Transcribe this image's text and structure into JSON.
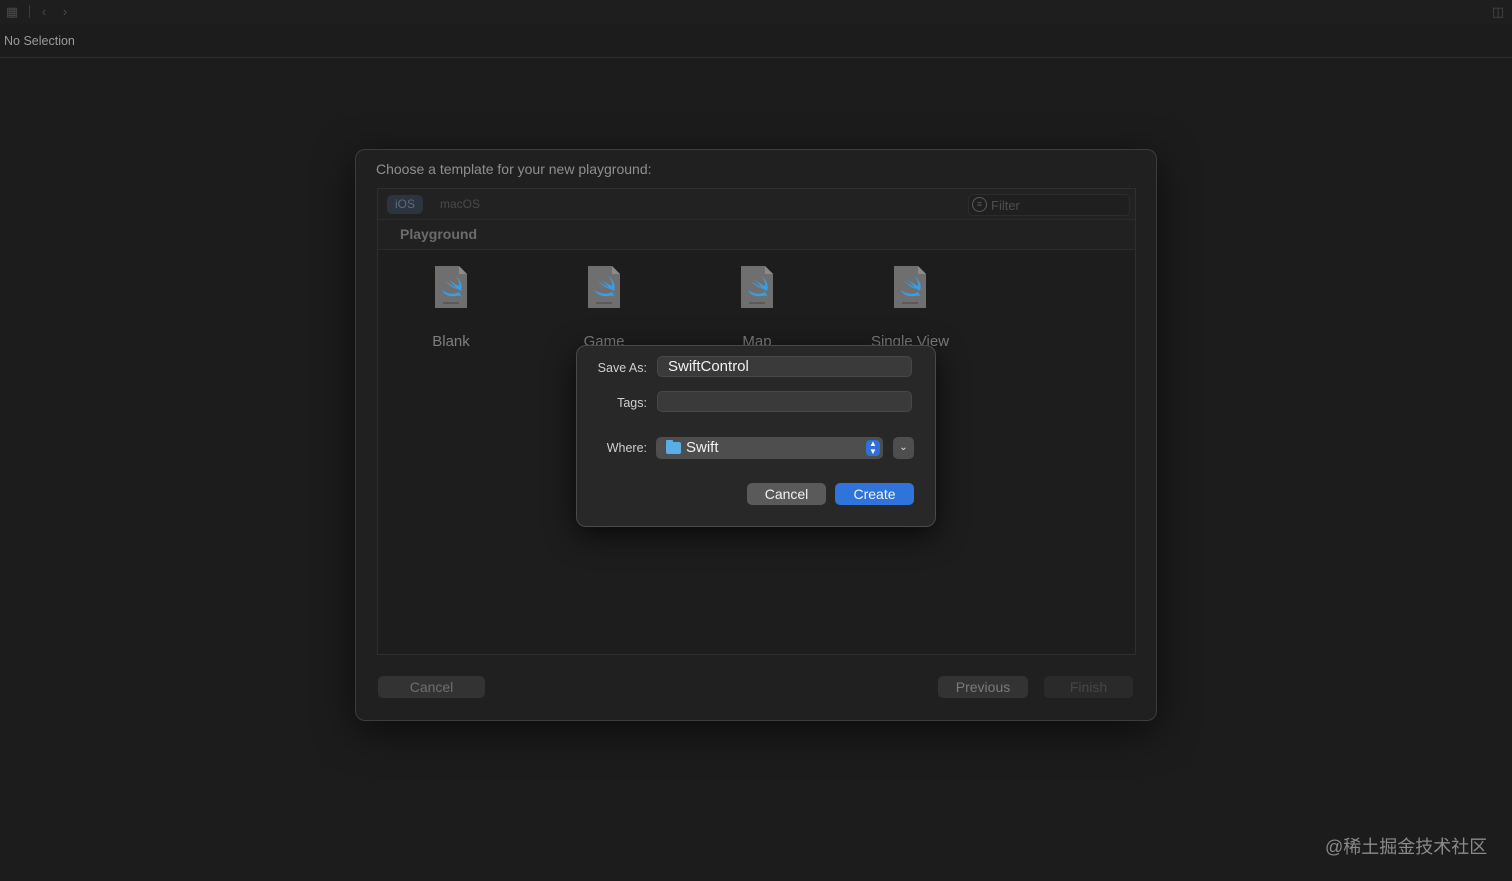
{
  "status": {
    "no_selection": "No Selection"
  },
  "template_sheet": {
    "title": "Choose a template for your new playground:",
    "tabs": [
      {
        "label": "iOS",
        "selected": true
      },
      {
        "label": "macOS",
        "selected": false
      }
    ],
    "filter_placeholder": "Filter",
    "section": "Playground",
    "templates": [
      {
        "label": "Blank",
        "icon": "swift-playground-file-icon"
      },
      {
        "label": "Game",
        "icon": "swift-playground-file-icon"
      },
      {
        "label": "Map",
        "icon": "swift-playground-file-icon"
      },
      {
        "label": "Single View",
        "icon": "swift-playground-file-icon"
      }
    ],
    "buttons": {
      "cancel": "Cancel",
      "previous": "Previous",
      "finish": "Finish"
    }
  },
  "save_dialog": {
    "save_as_label": "Save As:",
    "save_as_value": "SwiftControl",
    "tags_label": "Tags:",
    "tags_value": "",
    "where_label": "Where:",
    "where_value": "Swift",
    "cancel": "Cancel",
    "create": "Create"
  },
  "watermark": "@稀土掘金技术社区",
  "colors": {
    "accent": "#2f74da",
    "folder": "#5aaee6",
    "background": "#1c1c1c"
  }
}
